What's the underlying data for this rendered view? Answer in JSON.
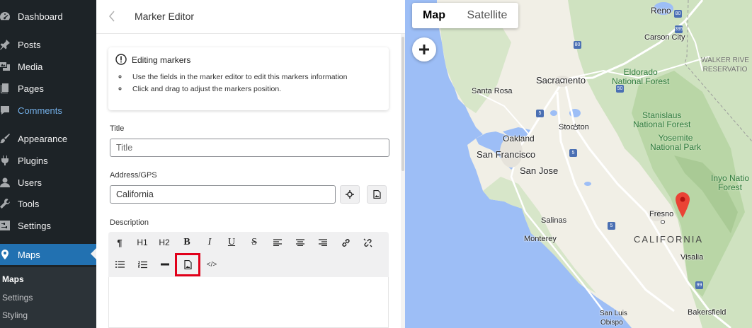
{
  "sidebar": {
    "items": [
      {
        "label": "Dashboard",
        "icon": "dashboard-icon"
      },
      {
        "label": "Posts",
        "icon": "pushpin-icon"
      },
      {
        "label": "Media",
        "icon": "media-icon"
      },
      {
        "label": "Pages",
        "icon": "pages-icon"
      },
      {
        "label": "Comments",
        "icon": "comments-icon"
      },
      {
        "label": "Appearance",
        "icon": "paintbrush-icon"
      },
      {
        "label": "Plugins",
        "icon": "plugin-icon"
      },
      {
        "label": "Users",
        "icon": "users-icon"
      },
      {
        "label": "Tools",
        "icon": "wrench-icon"
      },
      {
        "label": "Settings",
        "icon": "settings-icon"
      },
      {
        "label": "Maps",
        "icon": "location-pin-icon"
      }
    ],
    "submenu": [
      {
        "label": "Maps"
      },
      {
        "label": "Settings"
      },
      {
        "label": "Styling"
      }
    ],
    "colors": {
      "background": "#1d2327",
      "active": "#2271b1",
      "comments": "#72aee6"
    }
  },
  "editor": {
    "title": "Marker Editor",
    "notice": {
      "title": "Editing markers",
      "items": [
        "Use the fields in the marker editor to edit this markers information",
        "Click and drag to adjust the markers position."
      ]
    },
    "title_field": {
      "label": "Title",
      "placeholder": "Title",
      "value": ""
    },
    "address_field": {
      "label": "Address/GPS",
      "value": "California"
    },
    "description_label": "Description",
    "toolbar": {
      "paragraph": "¶",
      "h1": "H1",
      "h2": "H2",
      "bold": "B",
      "italic": "I",
      "underline": "U",
      "strike": "S",
      "code": "</>"
    },
    "highlight_color": "#e1001a"
  },
  "map": {
    "type_control": {
      "map": "Map",
      "satellite": "Satellite"
    },
    "zoom_in": "+",
    "cities": {
      "reno": "Reno",
      "carson_city": "Carson City",
      "sacramento": "Sacramento",
      "santa_rosa": "Santa Rosa",
      "stockton": "Stockton",
      "oakland": "Oakland",
      "san_francisco": "San Francisco",
      "san_jose": "San Jose",
      "salinas": "Salinas",
      "monterey": "Monterey",
      "fresno": "Fresno",
      "visalia": "Visalia",
      "bakersfield": "Bakersfield",
      "san_luis": "San Luis",
      "obispo": "Obispo"
    },
    "regions": {
      "eldorado": "Eldorado\nNational Forest",
      "stanislaus": "Stanislaus\nNational Forest",
      "yosemite": "Yosemite\nNational Park",
      "walker": "WALKER RIVE\nRESERVATIO",
      "inyo": "Inyo Natio\nForest"
    },
    "state": "CALIFORNIA",
    "highways": [
      "80",
      "80",
      "5",
      "5",
      "99",
      "5",
      "395",
      "50"
    ],
    "colors": {
      "ocean": "#9dbef6",
      "land": "#f1efe6",
      "forest": "#c8dfb9",
      "pin": "#ea4335"
    }
  }
}
